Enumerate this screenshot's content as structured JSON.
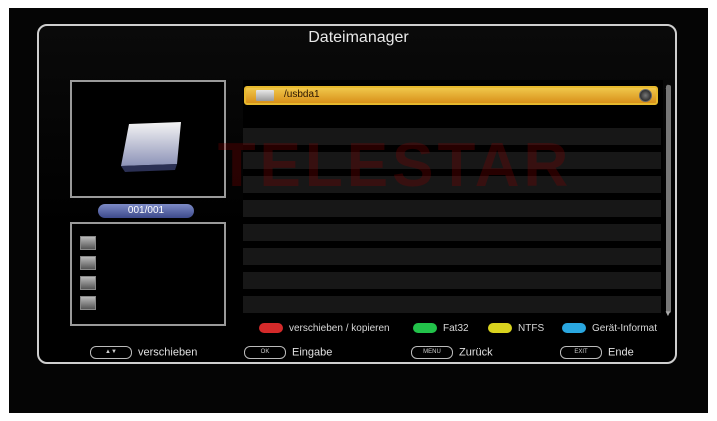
{
  "title": "Dateimanager",
  "counter": "001/001",
  "watermark": "TELESTAR",
  "list": {
    "items": [
      {
        "name": "/usbda1"
      }
    ]
  },
  "legend": [
    {
      "label": "verschieben / kopieren",
      "color": "#d42a2a"
    },
    {
      "label": "Fat32",
      "color": "#22c24a"
    },
    {
      "label": "NTFS",
      "color": "#d9d31e"
    },
    {
      "label": "Gerät-Informat",
      "color": "#2aa7e0"
    }
  ],
  "hints": [
    {
      "key": "▲▼",
      "label": "verschieben"
    },
    {
      "key": "OK",
      "label": "Eingabe"
    },
    {
      "key": "MENU",
      "label": "Zurück"
    },
    {
      "key": "EXIT",
      "label": "Ende"
    }
  ]
}
